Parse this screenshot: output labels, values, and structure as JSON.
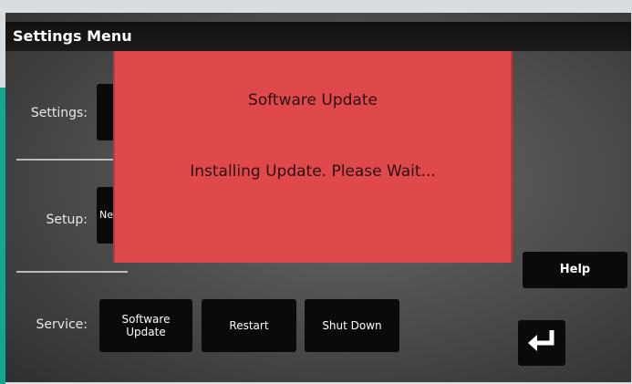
{
  "window": {
    "title": "Settings Menu"
  },
  "rows": {
    "settings": {
      "label": "Settings:"
    },
    "setup": {
      "label": "Setup:",
      "button_partial": "Ne"
    },
    "service": {
      "label": "Service:",
      "buttons": {
        "software_update": "Software\nUpdate",
        "restart": "Restart",
        "shut_down": "Shut Down"
      }
    }
  },
  "side": {
    "help_label": "Help",
    "back_icon": "return-arrow-icon"
  },
  "modal": {
    "title": "Software Update",
    "message": "Installing Update. Please Wait..."
  },
  "colors": {
    "modal_bg": "#e0494c",
    "accent_teal": "#19a58d",
    "button_bg": "#0a0a0a"
  }
}
